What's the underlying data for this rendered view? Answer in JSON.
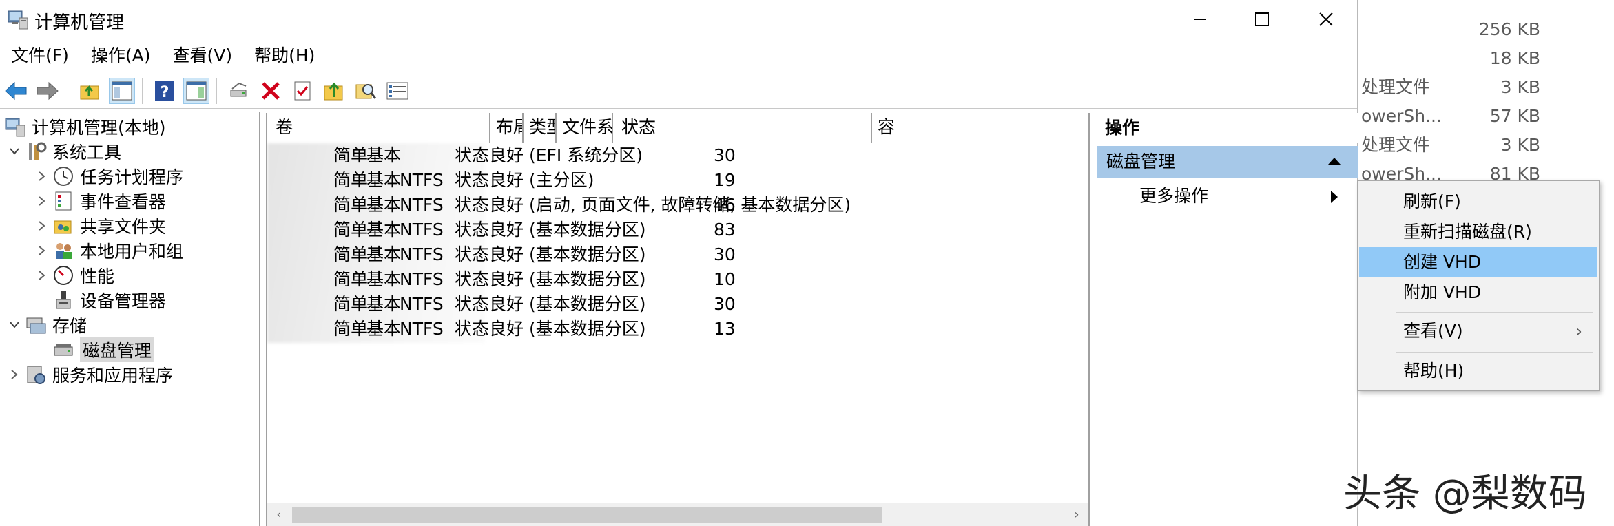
{
  "window": {
    "title": "计算机管理",
    "controls": [
      "minimize-icon",
      "maximize-icon",
      "close-icon"
    ]
  },
  "menubar": [
    "文件(F)",
    "操作(A)",
    "查看(V)",
    "帮助(H)"
  ],
  "toolbar": {
    "icons": [
      "back-arrow-icon",
      "forward-arrow-icon",
      "up-folder-icon",
      "show-hide-tree-icon",
      "help-icon",
      "action-pane-icon",
      "connect-drive-icon",
      "delete-icon",
      "properties-icon",
      "open-folder-icon",
      "search-icon",
      "list-view-icon"
    ]
  },
  "tree": {
    "root": "计算机管理(本地)",
    "system_tools": "系统工具",
    "task_scheduler": "任务计划程序",
    "event_viewer": "事件查看器",
    "shared_folders": "共享文件夹",
    "local_users": "本地用户和组",
    "performance": "性能",
    "device_manager": "设备管理器",
    "storage": "存储",
    "disk_management": "磁盘管理",
    "services": "服务和应用程序"
  },
  "volumes": {
    "columns": [
      "卷",
      "布局",
      "类型",
      "文件系统",
      "状态",
      "容"
    ],
    "rows": [
      {
        "layout": "简单",
        "type": "基本",
        "fs": "",
        "status": "状态良好 (EFI 系统分区)",
        "cap": "30"
      },
      {
        "layout": "简单",
        "type": "基本",
        "fs": "NTFS",
        "status": "状态良好 (主分区)",
        "cap": "19"
      },
      {
        "layout": "简单",
        "type": "基本",
        "fs": "NTFS",
        "status": "状态良好 (启动, 页面文件, 故障转储, 基本数据分区)",
        "cap": "46"
      },
      {
        "layout": "简单",
        "type": "基本",
        "fs": "NTFS",
        "status": "状态良好 (基本数据分区)",
        "cap": "83"
      },
      {
        "layout": "简单",
        "type": "基本",
        "fs": "NTFS",
        "status": "状态良好 (基本数据分区)",
        "cap": "30"
      },
      {
        "layout": "简单",
        "type": "基本",
        "fs": "NTFS",
        "status": "状态良好 (基本数据分区)",
        "cap": "10"
      },
      {
        "layout": "简单",
        "type": "基本",
        "fs": "NTFS",
        "status": "状态良好 (基本数据分区)",
        "cap": "30"
      },
      {
        "layout": "简单",
        "type": "基本",
        "fs": "NTFS",
        "status": "状态良好 (基本数据分区)",
        "cap": "13"
      }
    ]
  },
  "actions": {
    "header": "操作",
    "section": "磁盘管理",
    "more": "更多操作"
  },
  "context_menu": {
    "refresh": "刷新(F)",
    "rescan": "重新扫描磁盘(R)",
    "create_vhd": "创建 VHD",
    "attach_vhd": "附加 VHD",
    "view": "查看(V)",
    "help": "帮助(H)"
  },
  "background_files": [
    {
      "name": "",
      "size": "256 KB"
    },
    {
      "name": "",
      "size": "18 KB"
    },
    {
      "name": "处理文件",
      "size": "3 KB"
    },
    {
      "name": "owerSh...",
      "size": "57 KB"
    },
    {
      "name": "处理文件",
      "size": "3 KB"
    },
    {
      "name": "owerSh...",
      "size": "81 KB"
    }
  ],
  "watermark": "头条 @梨数码",
  "colors": {
    "selection": "#a6c8e8",
    "menu_highlight": "#91c9f7",
    "delete_red": "#d0021b"
  }
}
